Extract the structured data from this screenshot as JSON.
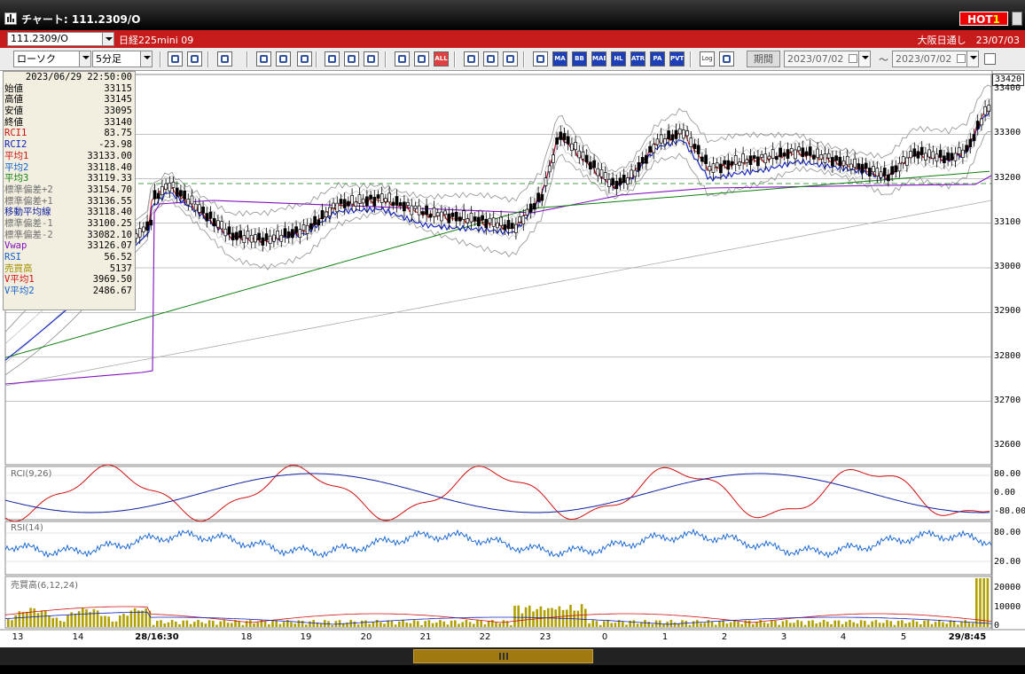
{
  "window": {
    "title": "チャート: 111.2309/O",
    "hot_badge": "HOT",
    "hot_num": "1"
  },
  "header": {
    "code_value": "111.2309/O",
    "contract_name": "日経225mini 09",
    "exchange_info": "大阪日通し　23/07/03"
  },
  "toolbar": {
    "chart_type": "ローソク",
    "interval": "5分足",
    "icons": [
      "zoom-in-icon",
      "crosshair-icon",
      "zoom-out-icon",
      "bar-chart-icon",
      "expand-icon",
      "grid-icon",
      "pencil-icon",
      "pointer-icon",
      "undo-icon",
      "candle-icon",
      "candle2-icon",
      "all-icon",
      "settings-icon",
      "brush-icon",
      "color-icon",
      "bollinger-icon",
      "ma-icon",
      "bb-icon",
      "mae-icon",
      "hl-icon",
      "atr-icon",
      "para-icon",
      "pvt-icon",
      "log-icon",
      "export-icon"
    ],
    "icon_texts": {
      "all": "ALL",
      "ma": "MA",
      "bb": "BB",
      "mae": "MAE",
      "hl": "HL",
      "atr": "ATR",
      "para": "PA RA",
      "pvt": "PVT",
      "log": "Log"
    },
    "period_label": "期間",
    "date_from": "2023/07/02",
    "date_tilde": "～",
    "date_to": "2023/07/02"
  },
  "info_panel": {
    "datetime": "2023/06/29  22:50:00",
    "rows": [
      {
        "label": "始値",
        "value": "33115",
        "color": "#000000"
      },
      {
        "label": "高値",
        "value": "33145",
        "color": "#000000"
      },
      {
        "label": "安値",
        "value": "33095",
        "color": "#000000"
      },
      {
        "label": "終値",
        "value": "33140",
        "color": "#000000"
      },
      {
        "label": "RCI1",
        "value": "83.75",
        "color": "#d01010"
      },
      {
        "label": "RCI2",
        "value": "-23.98",
        "color": "#1020c0"
      },
      {
        "label": "平均1",
        "value": "33133.00",
        "color": "#d01010"
      },
      {
        "label": "平均2",
        "value": "33118.40",
        "color": "#1060d0"
      },
      {
        "label": "平均3",
        "value": "33119.33",
        "color": "#108010"
      },
      {
        "label": "標準偏差+2",
        "value": "33154.70",
        "color": "#707070"
      },
      {
        "label": "標準偏差+1",
        "value": "33136.55",
        "color": "#707070"
      },
      {
        "label": "移動平均線",
        "value": "33118.40",
        "color": "#1020a0"
      },
      {
        "label": "標準偏差-1",
        "value": "33100.25",
        "color": "#707070"
      },
      {
        "label": "標準偏差-2",
        "value": "33082.10",
        "color": "#707070"
      },
      {
        "label": "Vwap",
        "value": "33126.07",
        "color": "#8010c0"
      },
      {
        "label": "RSI",
        "value": "56.52",
        "color": "#1060d0"
      },
      {
        "label": "売買高",
        "value": "5137",
        "color": "#a09000"
      },
      {
        "label": "V平均1",
        "value": "3969.50",
        "color": "#d01010"
      },
      {
        "label": "V平均2",
        "value": "2486.67",
        "color": "#1060d0"
      }
    ]
  },
  "price_axis": {
    "current_price": "33420",
    "labels": [
      "33400",
      "33300",
      "33200",
      "33100",
      "33000",
      "32900",
      "32800",
      "32700",
      "32600"
    ]
  },
  "rci_pane": {
    "label": "RCI(9,26)",
    "labels": [
      "80.00",
      "0.00",
      "-80.00"
    ]
  },
  "rsi_pane": {
    "label": "RSI(14)",
    "labels": [
      "80.00",
      "20.00"
    ]
  },
  "vol_pane": {
    "label": "売買高(6,12,24)",
    "labels": [
      "20000",
      "10000",
      "0"
    ]
  },
  "x_axis": {
    "labels": [
      {
        "text": "13",
        "bold": false
      },
      {
        "text": "14",
        "bold": false
      },
      {
        "text": "28/16:30",
        "bold": true
      },
      {
        "text": "18",
        "bold": false
      },
      {
        "text": "19",
        "bold": false
      },
      {
        "text": "20",
        "bold": false
      },
      {
        "text": "21",
        "bold": false
      },
      {
        "text": "22",
        "bold": false
      },
      {
        "text": "23",
        "bold": false
      },
      {
        "text": "0",
        "bold": false
      },
      {
        "text": "1",
        "bold": false
      },
      {
        "text": "2",
        "bold": false
      },
      {
        "text": "3",
        "bold": false
      },
      {
        "text": "4",
        "bold": false
      },
      {
        "text": "5",
        "bold": false
      },
      {
        "text": "29/8:45",
        "bold": true
      }
    ]
  },
  "colors": {
    "hot": "#e00000",
    "header_bar": "#c81c1c",
    "scroll_thumb": "#a07a10",
    "candle_up": "#ffffff",
    "candle_down": "#000000",
    "ma1": "#d01010",
    "ma2": "#1020c0",
    "ma3": "#108010",
    "vwap": "#8010c0",
    "bb": "#909090",
    "rci1": "#d01010",
    "rci2": "#1020a0",
    "rsi": "#1060d0",
    "vol": "#b0a000"
  }
}
